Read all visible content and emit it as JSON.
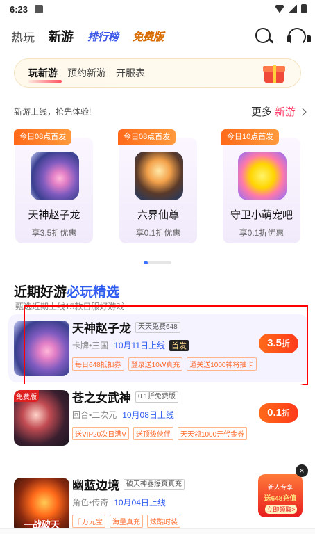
{
  "status": {
    "time": "6:23"
  },
  "topnav": {
    "tabs": [
      "热玩",
      "新游",
      "排行榜",
      "免费版"
    ]
  },
  "subtabs": [
    "玩新游",
    "预约新游",
    "开服表"
  ],
  "section1": {
    "title": "新游上线，抢先体验!",
    "more_prefix": "更多",
    "more_highlight": "新游"
  },
  "new_games": [
    {
      "badge": "今日08点首发",
      "name": "天神赵子龙",
      "discount": "享3.5折优惠"
    },
    {
      "badge": "今日08点首发",
      "name": "六界仙尊",
      "discount": "享0.1折优惠"
    },
    {
      "badge": "今日10点首发",
      "name": "守卫小萌宠吧",
      "discount": "享0.1折优惠"
    }
  ],
  "section2": {
    "title_prefix": "近期好游",
    "title_highlight": "必玩精选",
    "subtitle": "甄选近期上线15款日服好游戏"
  },
  "games": [
    {
      "name": "天神赵子龙",
      "tag": "天天免费648",
      "meta": "卡牌•三国",
      "date": "10月11日上线",
      "first": "首发",
      "tags": [
        "每日648抵扣券",
        "登录送10W真充",
        "通关送1000神将抽卡"
      ],
      "disc_value": "3.5",
      "disc_unit": "折"
    },
    {
      "name": "苍之女武神",
      "tag": "0.1折免费版",
      "meta": "回合•二次元",
      "date": "10月08日上线",
      "tags": [
        "送VIP20次日满V",
        "送顶级伙伴",
        "天天领1000元代金券"
      ],
      "disc_value": "0.1",
      "disc_unit": "折",
      "free_badge": "免费版"
    },
    {
      "name": "幽蓝边境",
      "tag": "破天神器爆爽真充",
      "meta": "角色•传奇",
      "date": "10月04日上线",
      "tags": [
        "千万元宝",
        "海量真充",
        "炫酷时装"
      ],
      "banner": "一战破天"
    }
  ],
  "float_ad": {
    "line1": "新人专享",
    "line2": "送648充值",
    "line3": "立即领取>",
    "close": "×"
  },
  "colors": {
    "accent_blue": "#2f5cf0",
    "accent_orange": "#ff6a1a",
    "accent_pink": "#ff3c64",
    "highlight_red": "#ff0000"
  }
}
